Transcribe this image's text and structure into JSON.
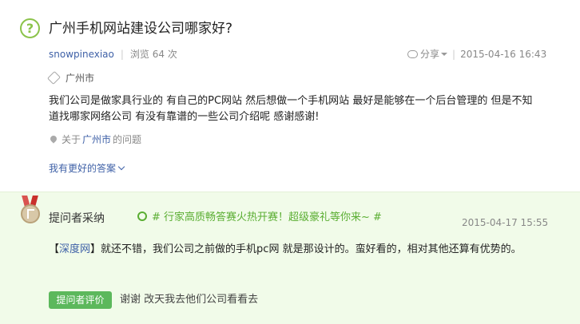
{
  "question": {
    "title": "广州手机网站建设公司哪家好?",
    "author": "snowpinexiao",
    "views": "浏览 64 次",
    "share_label": "分享",
    "date": "2015-04-16 16:43",
    "tag": "广州市",
    "body": "我们公司是做家具行业的  有自己的PC网站 然后想做一个手机网站 最好是能够在一个后台管理的 但是不知道找哪家网络公司  有没有靠谱的一些公司介绍呢  感谢感谢!",
    "about_prefix": "关于",
    "about_city": "广州市",
    "about_suffix": "的问题",
    "better_answer_link": "我有更好的答案"
  },
  "adopted": {
    "label": "提问者采纳",
    "promo": "# 行家高质畅答赛火热开赛！超级豪礼等你来~ #",
    "date": "2015-04-17 15:55",
    "source_open": "【",
    "source_name": "深度网",
    "source_close": "】",
    "answer_text": "就还不错，我们公司之前做的手机pc网  就是那设计的。蛮好看的，相对其他还算有优势的。",
    "eval_button": "提问者评价",
    "eval_text": "谢谢 改天我去他们公司看看去"
  },
  "icons": {
    "question": "question-circle-icon",
    "share": "share-bubble-icon",
    "tag": "tag-icon",
    "location": "location-pin-icon",
    "medal": "medal-icon",
    "promo": "clover-icon"
  },
  "colors": {
    "accent_green": "#8bc34a",
    "link_blue": "#3f61a7",
    "adopted_bg": "#f1fbe9",
    "button_green": "#5cb85c"
  }
}
